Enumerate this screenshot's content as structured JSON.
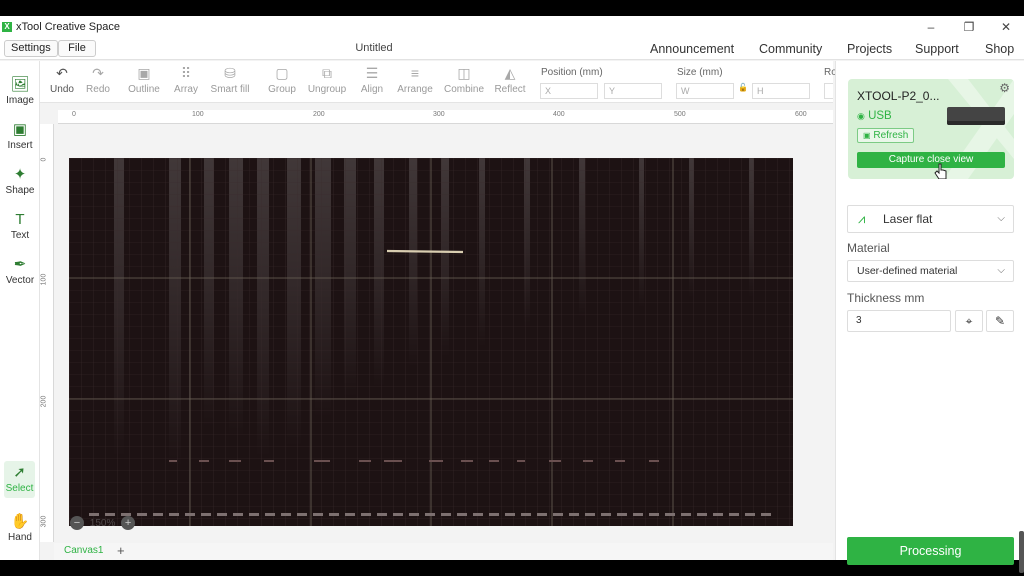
{
  "window": {
    "title": "xTool Creative Space",
    "logo_text": "X",
    "minimize": "–",
    "restore": "❐",
    "close": "✕"
  },
  "menubar": {
    "settings": "Settings",
    "file": "File",
    "doc_title": "Untitled",
    "nav": [
      "Announcement",
      "Community",
      "Projects",
      "Support",
      "Shop"
    ]
  },
  "toolbar": {
    "tools": [
      {
        "name": "undo",
        "label": "Undo",
        "icon": "↶"
      },
      {
        "name": "redo",
        "label": "Redo",
        "icon": "↷"
      },
      {
        "name": "outline",
        "label": "Outline",
        "icon": "▣"
      },
      {
        "name": "array",
        "label": "Array",
        "icon": "⠿"
      },
      {
        "name": "smart-fill",
        "label": "Smart fill",
        "icon": "⛁"
      },
      {
        "name": "group",
        "label": "Group",
        "icon": "▢"
      },
      {
        "name": "ungroup",
        "label": "Ungroup",
        "icon": "⧉"
      },
      {
        "name": "align",
        "label": "Align",
        "icon": "☰"
      },
      {
        "name": "arrange",
        "label": "Arrange",
        "icon": "≡"
      },
      {
        "name": "combine",
        "label": "Combine",
        "icon": "◫"
      },
      {
        "name": "reflect",
        "label": "Reflect",
        "icon": "◭"
      }
    ],
    "position_label": "Position (mm)",
    "size_label": "Size (mm)",
    "rotate_label": "Ro",
    "x_placeholder": "X",
    "y_placeholder": "Y",
    "w_placeholder": "W",
    "h_placeholder": "H",
    "lock_icon": "🔓"
  },
  "left_tools": [
    {
      "label": "Image",
      "icon": "🖼"
    },
    {
      "label": "Insert",
      "icon": "▣"
    },
    {
      "label": "Shape",
      "icon": "✦"
    },
    {
      "label": "Text",
      "icon": "T"
    },
    {
      "label": "Vector",
      "icon": "✒"
    }
  ],
  "left_tools_bottom": [
    {
      "label": "Select",
      "icon": "➚"
    },
    {
      "label": "Hand",
      "icon": "✋"
    }
  ],
  "rulers": {
    "h": [
      "0",
      "100",
      "200",
      "300",
      "400",
      "500",
      "600"
    ],
    "v": [
      "0",
      "100",
      "200",
      "300"
    ]
  },
  "canvas": {
    "zoom": "150%",
    "tab": "Canvas1",
    "add_tab": "+"
  },
  "device": {
    "name": "XTOOL-P2_0...",
    "connection": "USB",
    "refresh_label": "Refresh",
    "capture_label": "Capture close view"
  },
  "panel": {
    "mode": "Laser flat",
    "material_label": "Material",
    "material_value": "User-defined material",
    "thickness_label": "Thickness mm",
    "thickness_value": "3",
    "process_label": "Processing"
  }
}
